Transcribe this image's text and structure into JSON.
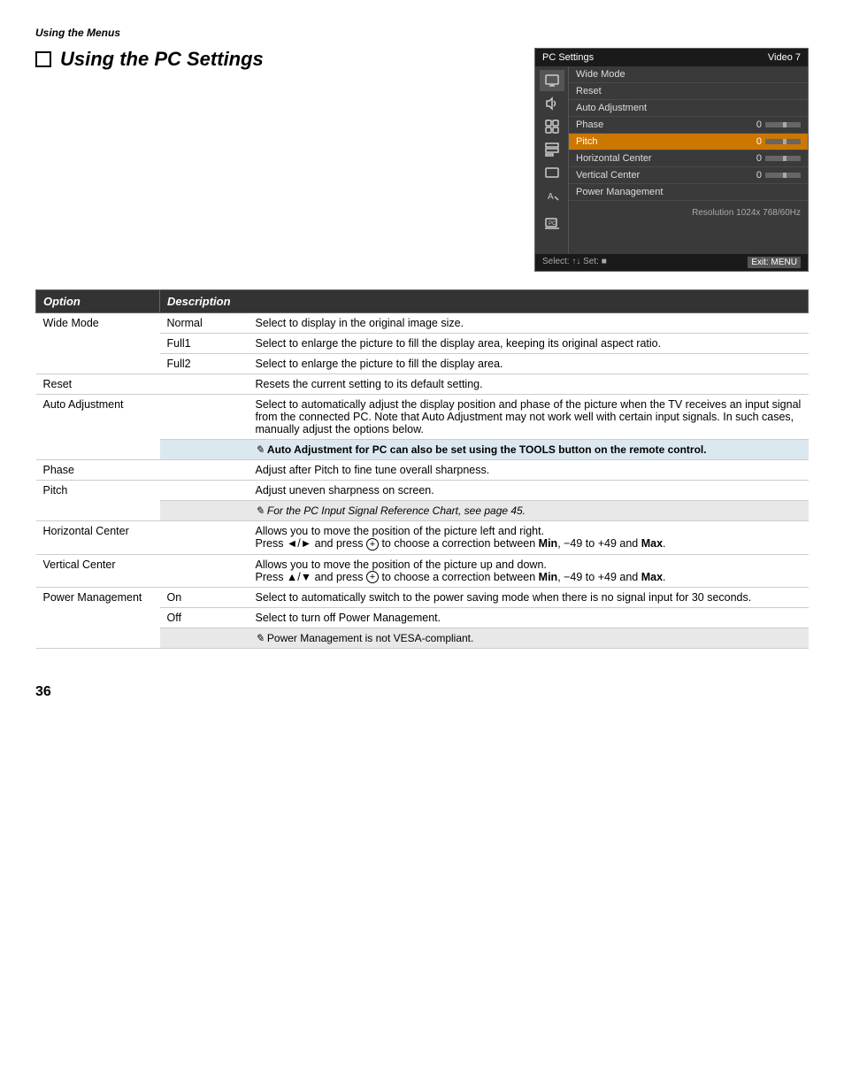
{
  "page": {
    "section_label": "Using the Menus",
    "title": "Using the PC Settings",
    "page_number": "36"
  },
  "panel": {
    "header_title": "PC Settings",
    "header_video": "Video 7",
    "menu_items": [
      {
        "label": "Wide Mode",
        "value": "",
        "slider": false,
        "highlighted": false
      },
      {
        "label": "Reset",
        "value": "",
        "slider": false,
        "highlighted": false
      },
      {
        "label": "Auto Adjustment",
        "value": "",
        "slider": false,
        "highlighted": false
      },
      {
        "label": "Phase",
        "value": "0",
        "slider": true,
        "highlighted": false
      },
      {
        "label": "Pitch",
        "value": "0",
        "slider": true,
        "highlighted": true
      },
      {
        "label": "Horizontal Center",
        "value": "0",
        "slider": true,
        "highlighted": false
      },
      {
        "label": "Vertical Center",
        "value": "0",
        "slider": true,
        "highlighted": false
      },
      {
        "label": "Power Management",
        "value": "",
        "slider": false,
        "highlighted": false
      }
    ],
    "resolution": "Resolution 1024x 768/60Hz",
    "footer_select": "Select: ↑↓ Set: ■",
    "footer_exit": "Exit: MENU"
  },
  "table": {
    "col_option": "Option",
    "col_description": "Description",
    "rows": [
      {
        "option": "Wide Mode",
        "entries": [
          {
            "value": "Normal",
            "desc": "Select to display in the original image size."
          },
          {
            "value": "Full1",
            "desc": "Select to enlarge the picture to fill the display area, keeping its original aspect ratio."
          },
          {
            "value": "Full2",
            "desc": "Select to enlarge the picture to fill the display area."
          }
        ]
      },
      {
        "option": "Reset",
        "entries": [
          {
            "value": "",
            "desc": "Resets the current setting to its default setting."
          }
        ]
      },
      {
        "option": "Auto Adjustment",
        "entries": [
          {
            "value": "",
            "desc": "Select to automatically adjust the display position and phase of the picture when the TV receives an input signal from the connected PC. Note that Auto Adjustment may not work well with certain input signals. In such cases, manually adjust the options below."
          },
          {
            "value": "note",
            "desc": "Auto Adjustment for PC can also be set using the TOOLS button on the remote control."
          }
        ]
      },
      {
        "option": "Phase",
        "entries": [
          {
            "value": "",
            "desc": "Adjust after Pitch to fine tune overall sharpness."
          }
        ]
      },
      {
        "option": "Pitch",
        "entries": [
          {
            "value": "",
            "desc": "Adjust uneven sharpness on screen."
          },
          {
            "value": "notelink",
            "desc": "For the PC Input Signal Reference Chart, see page 45."
          }
        ]
      },
      {
        "option": "Horizontal Center",
        "entries": [
          {
            "value": "",
            "desc": "Allows you to move the position of the picture left and right.\nPress ◄/► and press ⊕ to choose a correction between Min, −49 to +49 and Max."
          }
        ]
      },
      {
        "option": "Vertical Center",
        "entries": [
          {
            "value": "",
            "desc": "Allows you to move the position of the picture up and down.\nPress ▲/▼ and press ⊕ to choose a correction between Min, −49 to +49 and Max."
          }
        ]
      },
      {
        "option": "Power Management",
        "entries": [
          {
            "value": "On",
            "desc": "Select to automatically switch to the power saving mode when there is no signal input for 30 seconds."
          },
          {
            "value": "Off",
            "desc": "Select to turn off Power Management."
          },
          {
            "value": "note",
            "desc": "Power Management is not VESA-compliant."
          }
        ]
      }
    ]
  }
}
